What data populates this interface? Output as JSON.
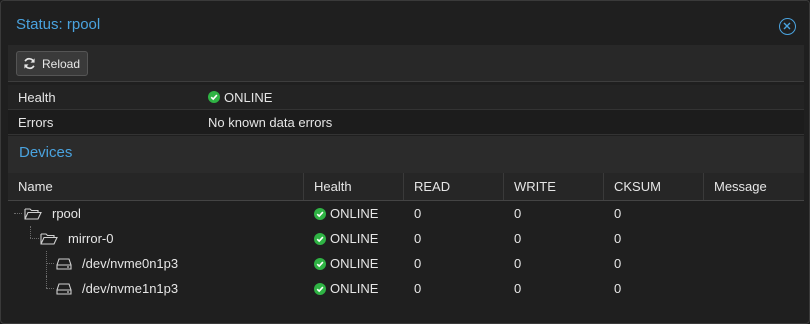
{
  "window": {
    "title": "Status: rpool"
  },
  "toolbar": {
    "reload_label": "Reload"
  },
  "info": [
    {
      "label": "Health",
      "value": "ONLINE",
      "icon": "check-circle-icon"
    },
    {
      "label": "Errors",
      "value": "No known data errors"
    }
  ],
  "devices": {
    "title": "Devices",
    "columns": [
      "Name",
      "Health",
      "READ",
      "WRITE",
      "CKSUM",
      "Message"
    ],
    "rows": [
      {
        "name": "rpool",
        "health": "ONLINE",
        "read": "0",
        "write": "0",
        "cksum": "0",
        "message": "",
        "icon": "folder-open-icon"
      },
      {
        "name": "mirror-0",
        "health": "ONLINE",
        "read": "0",
        "write": "0",
        "cksum": "0",
        "message": "",
        "icon": "folder-open-icon"
      },
      {
        "name": "/dev/nvme0n1p3",
        "health": "ONLINE",
        "read": "0",
        "write": "0",
        "cksum": "0",
        "message": "",
        "icon": "hdd-icon"
      },
      {
        "name": "/dev/nvme1n1p3",
        "health": "ONLINE",
        "read": "0",
        "write": "0",
        "cksum": "0",
        "message": "",
        "icon": "hdd-icon"
      }
    ]
  },
  "colors": {
    "accent": "#4aa3df",
    "ok": "#2fb344"
  }
}
